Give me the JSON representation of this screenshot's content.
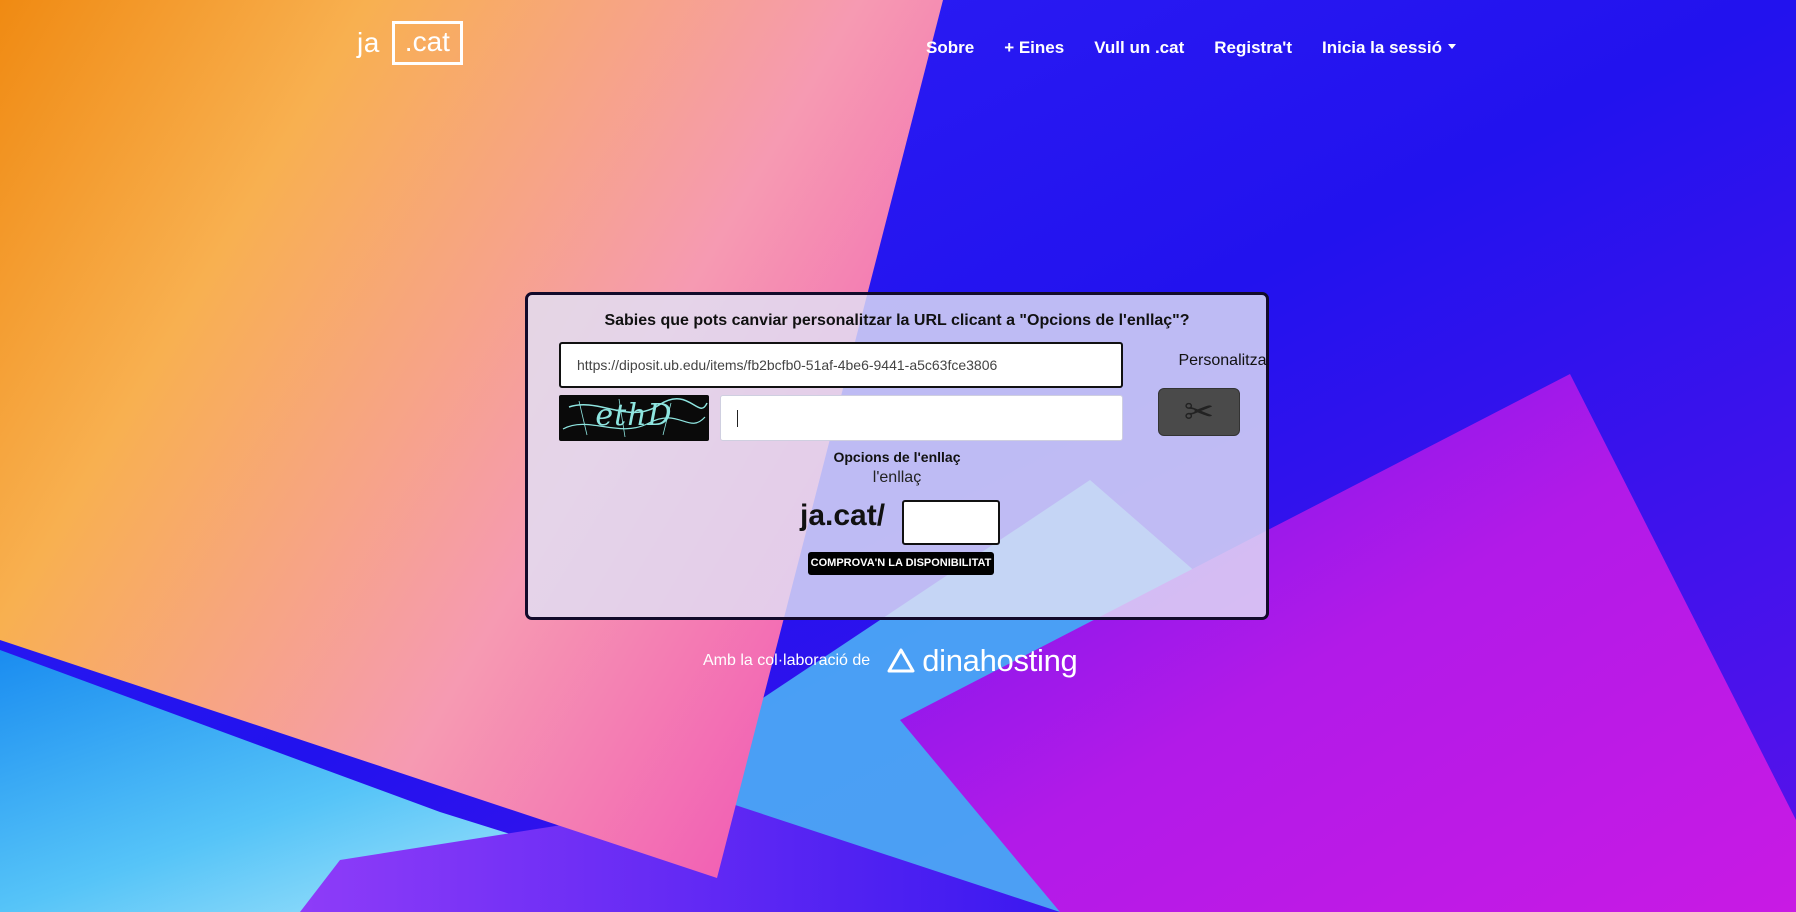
{
  "header": {
    "logo": {
      "part1": "ja",
      "part2": ".cat"
    },
    "nav": [
      {
        "label": "Sobre"
      },
      {
        "label": "+ Eines"
      },
      {
        "label": "Vull un .cat"
      },
      {
        "label": "Registra't"
      },
      {
        "label": "Inicia la sessió"
      }
    ]
  },
  "card": {
    "title": "Sabies que pots canviar personalitzar la URL clicant a \"Opcions de l'enllaç\"?",
    "url_value": "https://diposit.ub.edu/items/fb2bcfb0-51af-4be6-9441-a5c63fce3806",
    "captcha_text": "ethD",
    "personalitza_label": "Personalitza",
    "cut_icon": "scissors-icon",
    "options_title": "Opcions de l'enllaç",
    "options_sub": "l'enllaç",
    "prefix": "ja.cat/",
    "slug_value": "",
    "check_button": "COMPROVA'N LA DISPONIBILITAT"
  },
  "footer": {
    "collab_text": "Amb la col·laboració de",
    "partner_name": "dinahosting",
    "partner_icon": "triangle-logo-icon"
  },
  "colors": {
    "orange": "#f08a12",
    "pink": "#f263b4",
    "blue": "#2a16f0",
    "magenta": "#b21ae8",
    "card_border": "#120a2a"
  }
}
